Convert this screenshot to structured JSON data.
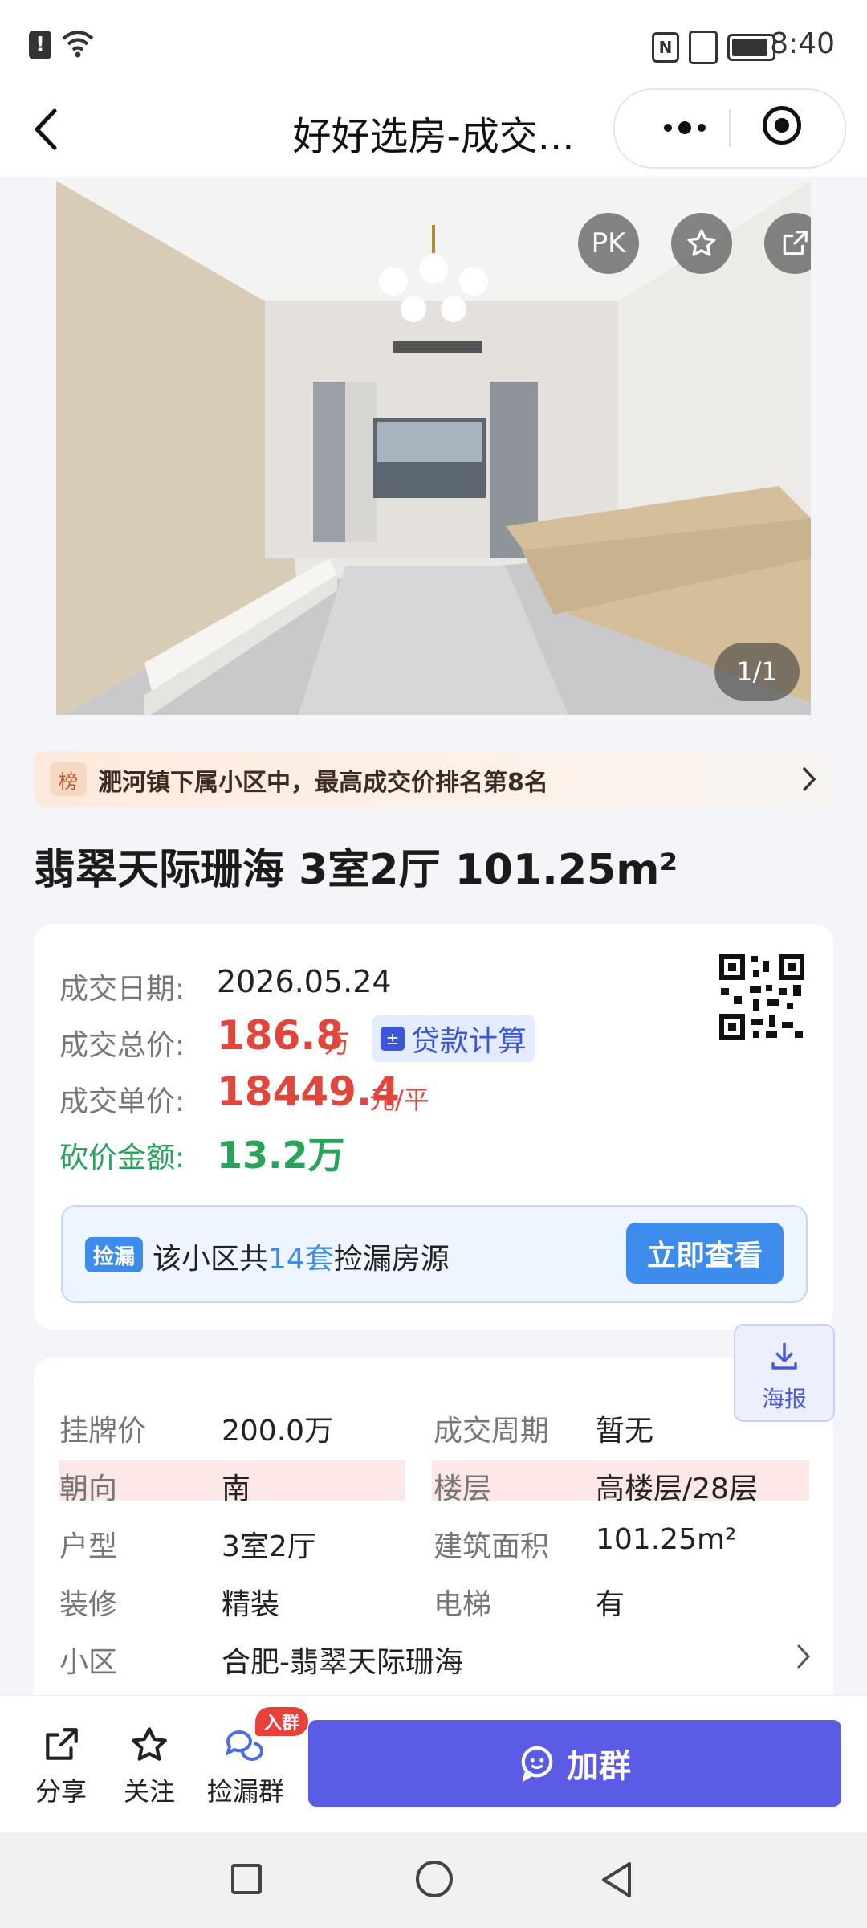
{
  "status_bar": {
    "time": "8:40"
  },
  "nav": {
    "title": "好好选房-成交..."
  },
  "hero": {
    "pager": "1/1",
    "pk_label": "PK"
  },
  "rank_banner": {
    "badge": "榜",
    "text": "淝河镇下属小区中，最高成交价排名第8名"
  },
  "listing": {
    "title": "翡翠天际珊海 3室2厅 101.25m²"
  },
  "deal": {
    "date_label": "成交日期:",
    "date_value": "2026.05.24",
    "total_label": "成交总价:",
    "total_value": "186.8",
    "total_unit": "万",
    "loan_label": "贷款计算",
    "unit_label": "成交单价:",
    "unit_value": "18449.4",
    "unit_unit": "元/平",
    "cut_label": "砍价金额:",
    "cut_value": "13.2万"
  },
  "leak": {
    "tag": "捡漏",
    "text_prefix": "该小区共",
    "count": "14套",
    "text_suffix": "捡漏房源",
    "button": "立即查看"
  },
  "poster": {
    "label": "海报"
  },
  "details": [
    {
      "label": "挂牌价",
      "value": "200.0万",
      "label2": "成交周期",
      "value2": "暂无"
    },
    {
      "label": "朝向",
      "value": "南",
      "label2": "楼层",
      "value2": "高楼层/28层"
    },
    {
      "label": "户型",
      "value": "3室2厅",
      "label2": "建筑面积",
      "value2": "101.25m²"
    },
    {
      "label": "装修",
      "value": "精装",
      "label2": "电梯",
      "value2": "有"
    },
    {
      "label": "小区",
      "value": "合肥-翡翠天际珊海"
    }
  ],
  "actions": {
    "share": "分享",
    "follow": "关注",
    "leak_group": "捡漏群",
    "join_badge": "入群",
    "join_button": "加群"
  },
  "colors": {
    "accent_red": "#e0463c",
    "accent_green": "#29a35a",
    "accent_blue": "#3d8bea",
    "join_purple": "#5b5ce6"
  }
}
